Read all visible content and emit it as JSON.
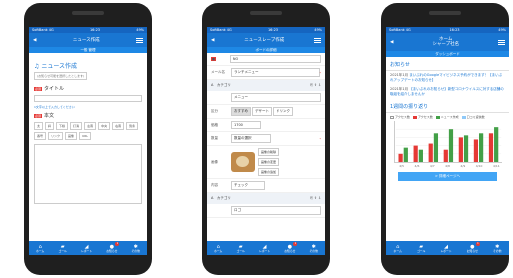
{
  "phones": [
    {
      "status": {
        "carrier": "SoftBank 4G",
        "time": "16:23",
        "battery": "49%"
      },
      "appbar": {
        "title": "ニュース作成"
      },
      "subbar": "一般 管理",
      "form": {
        "heading": "ニュース作成",
        "help": "(お知らせ可能を選択したとします)",
        "title_label": "タイトル",
        "required": "必須",
        "hint": "1文字以上で入力してください",
        "body_label": "本文",
        "tools": [
          "太",
          "斜",
          "下線",
          "打消",
          "左寄",
          "中央",
          "右寄",
          "箇条",
          "番号",
          "リンク",
          "画像",
          "URL"
        ]
      },
      "tabs": [
        {
          "label": "ホーム",
          "icon": "home-icon",
          "glyph": "⌂"
        },
        {
          "label": "ゴール",
          "icon": "folder-icon",
          "glyph": "▰"
        },
        {
          "label": "レポート",
          "icon": "chart-icon",
          "glyph": "◢"
        },
        {
          "label": "お知らせ",
          "icon": "bell-icon",
          "glyph": "●",
          "badge": "1"
        },
        {
          "label": "その他",
          "icon": "gear-icon",
          "glyph": "✱"
        }
      ]
    },
    {
      "status": {
        "carrier": "SoftBank 4G",
        "time": "16:23",
        "battery": "49%"
      },
      "appbar": {
        "title": "ニュースレーブ作成"
      },
      "subbar": "ボードの詳細",
      "rows": [
        {
          "label": "",
          "value": "NO"
        },
        {
          "label": "メール名",
          "value": "ランチメニュー"
        },
        {
          "label": "",
          "value": ""
        }
      ],
      "sections": [
        {
          "title": "A　カテゴリ",
          "ops": "⎘ ⇧ ⇩"
        },
        {
          "title": "A　カテゴリ",
          "ops": "⎘ ⇧ ⇩"
        }
      ],
      "fields": {
        "item": "メニュー",
        "type_label": "区分",
        "seg": [
          "おすすめ",
          "デザート",
          "ドリンク"
        ],
        "price_label": "価格",
        "price": "1700",
        "qty_label": "数量",
        "qty": "数量の選択",
        "img_label": "画像",
        "btns": [
          "画像の削除",
          "画像の変更",
          "画像の追加"
        ],
        "order_label": "内容",
        "order_value": "チェック",
        "bottom_value": "ロゴ"
      },
      "tabs": [
        {
          "label": "ホーム",
          "icon": "home-icon",
          "glyph": "⌂"
        },
        {
          "label": "ゴール",
          "icon": "folder-icon",
          "glyph": "▰"
        },
        {
          "label": "レポート",
          "icon": "chart-icon",
          "glyph": "◢"
        },
        {
          "label": "お知らせ",
          "icon": "bell-icon",
          "glyph": "●",
          "badge": "1"
        },
        {
          "label": "その他",
          "icon": "gear-icon",
          "glyph": "✱"
        }
      ]
    },
    {
      "status": {
        "carrier": "SoftBank 4G",
        "time": "16:23",
        "battery": "49%"
      },
      "appbar": {
        "title": "ホーム\nシャープ社名"
      },
      "subbar": "ダッシュボード",
      "news_title": "お知らせ",
      "news": [
        {
          "date": "2021年1月",
          "text": "まいぶれのGoogleマイビジネス予約ができます！【まいぶれアップデートのお知らせ】"
        },
        {
          "date": "2021年1月",
          "text": "【まいぶれのお知らせ】新型コロナウイルスに対する店舗の取組を紹介しませんか"
        }
      ],
      "chart_title": "1週間の振り返り",
      "legend": [
        {
          "label": "アクセス数",
          "color": "#ffffff"
        },
        {
          "label": "アクセス数",
          "color": "#e53935"
        },
        {
          "label": "ニュース作成",
          "color": "#43a047"
        },
        {
          "label": "口コミ返信数",
          "color": "#90caf9"
        }
      ],
      "chart_data": {
        "type": "bar",
        "categories": [
          "4/5",
          "4/6",
          "4/7",
          "4/8",
          "4/9",
          "4/10",
          "4/11"
        ],
        "series": [
          {
            "name": "アクセス数",
            "values": [
              20,
              40,
              45,
              30,
              60,
              55,
              70
            ]
          },
          {
            "name": "ニュース作成",
            "values": [
              35,
              30,
              70,
              80,
              65,
              70,
              85
            ]
          }
        ],
        "yticks": [
          "100",
          "80",
          "60",
          "40",
          "20",
          "0"
        ],
        "ylim": [
          0,
          100
        ]
      },
      "cta": "> 詳細ページへ",
      "tabs": [
        {
          "label": "ホーム",
          "icon": "home-icon",
          "glyph": "⌂"
        },
        {
          "label": "ゴール",
          "icon": "folder-icon",
          "glyph": "▰"
        },
        {
          "label": "レポート",
          "icon": "chart-icon",
          "glyph": "◢"
        },
        {
          "label": "お知らせ",
          "icon": "bell-icon",
          "glyph": "●",
          "badge": "1"
        },
        {
          "label": "その他",
          "icon": "gear-icon",
          "glyph": "✱"
        }
      ]
    }
  ]
}
